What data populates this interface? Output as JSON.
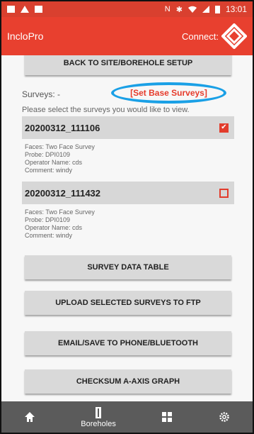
{
  "status_bar": {
    "time": "13:01",
    "left_icons": [
      "notification-icon",
      "alert-icon",
      "image-icon"
    ],
    "right_icons": [
      "nfc-icon",
      "bluetooth-icon",
      "wifi-icon",
      "signal-icon",
      "battery-icon"
    ]
  },
  "app_bar": {
    "title": "IncloPro",
    "connect_label": "Connect:",
    "logo_icon": "diamond-logo-icon"
  },
  "colors": {
    "status_bar": "#d9402f",
    "app_bar": "#e8402f",
    "accent": "#e23c2c",
    "highlight_ring": "#1aa0e6",
    "bottom_nav": "#5b5b5b",
    "button_bg": "#d9d9d9"
  },
  "buttons": {
    "back": "BACK TO SITE/BOREHOLE SETUP",
    "survey_data_table": "SURVEY DATA TABLE",
    "upload_ftp": "UPLOAD SELECTED SURVEYS TO FTP",
    "email_save": "EMAIL/SAVE TO PHONE/BLUETOOTH",
    "checksum": "CHECKSUM A-AXIS GRAPH"
  },
  "surveys_section": {
    "label": "Surveys: -",
    "set_base_link": "[Set Base Surveys]",
    "hint": "Please select the surveys you would like to view."
  },
  "surveys": [
    {
      "name": "20200312_111106",
      "checked": true,
      "faces": "Faces: Two Face Survey",
      "probe": "Probe: DPI0109",
      "operator": "Operator Name: cds",
      "comment": "Comment: windy"
    },
    {
      "name": "20200312_111432",
      "checked": false,
      "faces": "Faces: Two Face Survey",
      "probe": "Probe: DPI0109",
      "operator": "Operator Name: cds",
      "comment": "Comment: windy"
    }
  ],
  "bottom_nav": {
    "items": [
      {
        "icon": "home-icon",
        "label": ""
      },
      {
        "icon": "borehole-icon",
        "label": "Boreholes"
      },
      {
        "icon": "grid-icon",
        "label": ""
      },
      {
        "icon": "settings-gear-icon",
        "label": ""
      }
    ]
  }
}
